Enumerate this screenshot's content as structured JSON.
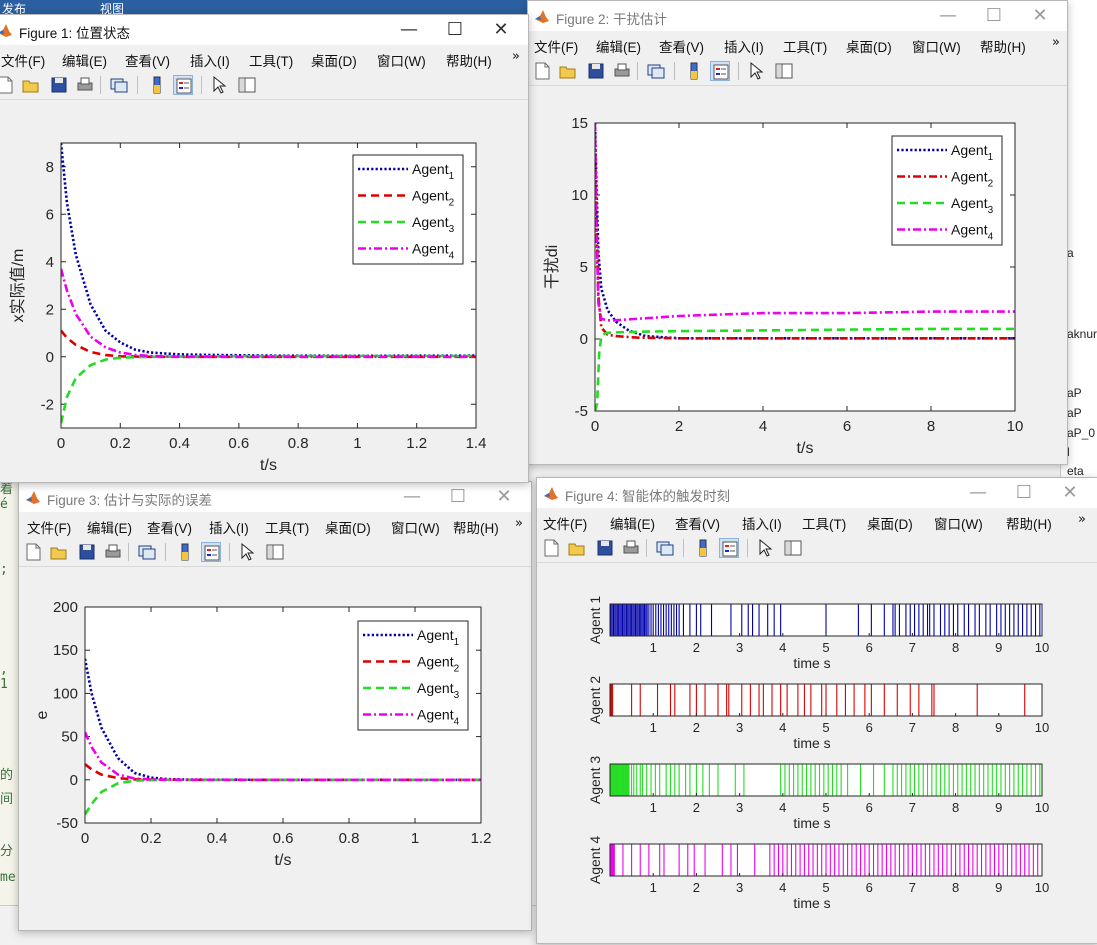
{
  "background": {
    "top_tabs": [
      "发布",
      "视图"
    ],
    "right_fragments": [
      "a",
      "aknur",
      "aP",
      "aP",
      "aP_0",
      "l",
      "eta"
    ],
    "left_fragments": [
      "着é",
      ";",
      ", 1",
      "的",
      "间",
      "分",
      "me"
    ]
  },
  "menu_labels": [
    "文件(F)",
    "编辑(E)",
    "查看(V)",
    "插入(I)",
    "工具(T)",
    "桌面(D)",
    "窗口(W)",
    "帮助(H)"
  ],
  "menu_more": "»",
  "window_controls": {
    "minimize": "—",
    "maximize": "☐",
    "close": "✕"
  },
  "toolbar_icons": [
    "new-figure-icon",
    "open-file-icon",
    "save-icon",
    "print-icon",
    "link-plot-icon",
    "insert-colorbar-icon",
    "insert-legend-icon",
    "pointer-icon",
    "property-inspector-icon"
  ],
  "colors": {
    "agent1": "#0000aa",
    "agent2": "#dd0000",
    "agent3": "#22dd22",
    "agent4": "#ee00ee",
    "matlab_gray": "#f0f0f0",
    "selected_tool": "#cfe1f5"
  },
  "legend_labels": [
    "Agent",
    "Agent",
    "Agent",
    "Agent"
  ],
  "legend_subscripts": [
    "1",
    "2",
    "3",
    "4"
  ],
  "figures": {
    "fig1": {
      "title": "Figure 1: 位置状态",
      "active": true
    },
    "fig2": {
      "title": "Figure 2: 干扰估计",
      "active": false
    },
    "fig3": {
      "title": "Figure 3: 估计与实际的误差",
      "active": false
    },
    "fig4": {
      "title": "Figure 4: 智能体的触发时刻",
      "active": false
    }
  },
  "chart_data": [
    {
      "id": "fig1",
      "type": "line",
      "xlabel": "t/s",
      "ylabel": "x实际值/m",
      "xlim": [
        0,
        1.4
      ],
      "ylim": [
        -3,
        9
      ],
      "xticks": [
        0,
        0.2,
        0.4,
        0.6,
        0.8,
        1,
        1.2,
        1.4
      ],
      "xtick_labels": [
        "0",
        "0.2",
        "0.4",
        "0.6",
        "0.8",
        "1",
        "1.2",
        "1.4"
      ],
      "yticks": [
        -2,
        0,
        2,
        4,
        6,
        8
      ],
      "ytick_labels": [
        "-2",
        "0",
        "2",
        "4",
        "6",
        "8"
      ],
      "legend": "top-right",
      "series": [
        {
          "name": "Agent1",
          "style": "dotted",
          "x": [
            0,
            0.02,
            0.05,
            0.1,
            0.15,
            0.2,
            0.25,
            0.3,
            0.4,
            0.5,
            0.7,
            1.0,
            1.4
          ],
          "y": [
            9,
            6.5,
            4.3,
            2.2,
            1.1,
            0.6,
            0.3,
            0.18,
            0.1,
            0.08,
            0.05,
            0.04,
            0.05
          ]
        },
        {
          "name": "Agent2",
          "style": "dashed",
          "x": [
            0,
            0.02,
            0.05,
            0.1,
            0.15,
            0.2,
            0.3,
            0.5,
            1.0,
            1.4
          ],
          "y": [
            1.1,
            0.8,
            0.5,
            0.2,
            0.07,
            0.02,
            0.0,
            0.0,
            0.0,
            0.0
          ]
        },
        {
          "name": "Agent3",
          "style": "dashed",
          "x": [
            0,
            0.02,
            0.05,
            0.1,
            0.15,
            0.2,
            0.3,
            0.5,
            1.0,
            1.4
          ],
          "y": [
            -2.8,
            -1.7,
            -0.9,
            -0.35,
            -0.12,
            -0.04,
            0.0,
            0.02,
            0.03,
            0.03
          ]
        },
        {
          "name": "Agent4",
          "style": "dashdot",
          "x": [
            0,
            0.02,
            0.05,
            0.1,
            0.15,
            0.2,
            0.25,
            0.3,
            0.4,
            0.6,
            1.0,
            1.4
          ],
          "y": [
            3.7,
            2.8,
            1.8,
            0.85,
            0.4,
            0.18,
            0.08,
            0.03,
            0.0,
            0.0,
            0.0,
            0.0
          ]
        }
      ]
    },
    {
      "id": "fig2",
      "type": "line",
      "xlabel": "t/s",
      "ylabel": "干扰di",
      "xlim": [
        0,
        10
      ],
      "ylim": [
        -5,
        15
      ],
      "xticks": [
        0,
        2,
        4,
        6,
        8,
        10
      ],
      "xtick_labels": [
        "0",
        "2",
        "4",
        "6",
        "8",
        "10"
      ],
      "yticks": [
        -5,
        0,
        5,
        10,
        15
      ],
      "ytick_labels": [
        "-5",
        "0",
        "5",
        "10",
        "15"
      ],
      "legend": "top-right",
      "series": [
        {
          "name": "Agent1",
          "style": "dotted",
          "x": [
            0,
            0.03,
            0.08,
            0.15,
            0.3,
            0.5,
            0.8,
            1.2,
            2,
            4,
            6,
            8,
            10
          ],
          "y": [
            15,
            11,
            6,
            3.5,
            2,
            1.2,
            0.6,
            0.2,
            0.05,
            0.05,
            0.05,
            0.05,
            0.05
          ]
        },
        {
          "name": "Agent2",
          "style": "dashdot",
          "x": [
            0,
            0.03,
            0.08,
            0.15,
            0.3,
            0.5,
            1,
            2,
            4,
            6,
            8,
            10
          ],
          "y": [
            14,
            9,
            3,
            0.8,
            0.3,
            0.2,
            0.1,
            0.05,
            0.05,
            0.05,
            0.05,
            0.05
          ]
        },
        {
          "name": "Agent3",
          "style": "dashed",
          "x": [
            0,
            0.05,
            0.1,
            0.15,
            0.25,
            0.4,
            1,
            2,
            4,
            6,
            8,
            10
          ],
          "y": [
            -5,
            -4.5,
            -1,
            0.2,
            0.4,
            0.45,
            0.5,
            0.55,
            0.6,
            0.65,
            0.7,
            0.7
          ]
        },
        {
          "name": "Agent4",
          "style": "dashdot",
          "x": [
            0,
            0.03,
            0.08,
            0.15,
            0.3,
            0.5,
            1,
            1.5,
            2,
            3,
            4,
            6,
            8,
            10
          ],
          "y": [
            15,
            8,
            2.5,
            1.4,
            1.3,
            1.3,
            1.4,
            1.5,
            1.6,
            1.7,
            1.8,
            1.8,
            1.9,
            1.9
          ]
        }
      ]
    },
    {
      "id": "fig3",
      "type": "line",
      "xlabel": "t/s",
      "ylabel": "e",
      "xlim": [
        0,
        1.2
      ],
      "ylim": [
        -50,
        200
      ],
      "xticks": [
        0,
        0.2,
        0.4,
        0.6,
        0.8,
        1,
        1.2
      ],
      "xtick_labels": [
        "0",
        "0.2",
        "0.4",
        "0.6",
        "0.8",
        "1",
        "1.2"
      ],
      "yticks": [
        -50,
        0,
        50,
        100,
        150,
        200
      ],
      "ytick_labels": [
        "-50",
        "0",
        "50",
        "100",
        "150",
        "200"
      ],
      "legend": "top-right",
      "series": [
        {
          "name": "Agent1",
          "style": "dotted",
          "x": [
            0,
            0.02,
            0.05,
            0.1,
            0.15,
            0.2,
            0.25,
            0.3,
            0.4,
            0.6,
            1.2
          ],
          "y": [
            140,
            100,
            60,
            25,
            8,
            2.5,
            0.8,
            0.3,
            0.1,
            0,
            0
          ]
        },
        {
          "name": "Agent2",
          "style": "dashed",
          "x": [
            0,
            0.02,
            0.05,
            0.1,
            0.15,
            0.2,
            0.3,
            1.2
          ],
          "y": [
            18,
            12,
            6,
            2,
            0.5,
            0.2,
            0,
            0
          ]
        },
        {
          "name": "Agent3",
          "style": "dashed",
          "x": [
            0,
            0.02,
            0.05,
            0.1,
            0.15,
            0.2,
            0.3,
            1.2
          ],
          "y": [
            -40,
            -28,
            -14,
            -4,
            -1,
            -0.3,
            0,
            0
          ]
        },
        {
          "name": "Agent4",
          "style": "dashdot",
          "x": [
            0,
            0.02,
            0.05,
            0.1,
            0.15,
            0.2,
            0.25,
            0.3,
            1.2
          ],
          "y": [
            55,
            38,
            20,
            6,
            1.5,
            0.5,
            0.1,
            0,
            0
          ]
        }
      ]
    },
    {
      "id": "fig4",
      "type": "event",
      "xlabel": "time s",
      "xlim": [
        0,
        10
      ],
      "xticks": [
        1,
        2,
        3,
        4,
        5,
        6,
        7,
        8,
        9,
        10
      ],
      "xtick_labels": [
        "1",
        "2",
        "3",
        "4",
        "5",
        "6",
        "7",
        "8",
        "9",
        "10"
      ],
      "panels": [
        {
          "name": "Agent 1",
          "times": [
            0.02,
            0.05,
            0.08,
            0.11,
            0.14,
            0.17,
            0.2,
            0.23,
            0.26,
            0.29,
            0.32,
            0.35,
            0.38,
            0.41,
            0.44,
            0.47,
            0.5,
            0.53,
            0.56,
            0.59,
            0.62,
            0.65,
            0.68,
            0.71,
            0.74,
            0.77,
            0.8,
            0.83,
            0.86,
            0.9,
            0.95,
            1.0,
            1.06,
            1.12,
            1.18,
            1.24,
            1.3,
            1.36,
            1.42,
            1.48,
            1.54,
            1.6,
            1.7,
            1.85,
            2.0,
            2.1,
            2.35,
            2.8,
            3.05,
            3.2,
            3.3,
            3.45,
            3.65,
            3.8,
            3.95,
            5.0,
            5.75,
            6.05,
            6.35,
            6.55,
            6.6,
            6.7,
            6.85,
            6.95,
            7.05,
            7.15,
            7.25,
            7.35,
            7.4,
            7.5,
            7.65,
            7.75,
            7.85,
            7.95,
            8.05,
            8.2,
            8.3,
            8.45,
            8.55,
            8.7,
            8.8,
            8.95,
            9.05,
            9.15,
            9.25,
            9.35,
            9.45,
            9.55,
            9.65,
            9.75,
            9.85,
            9.95
          ]
        },
        {
          "name": "Agent 2",
          "times": [
            0.02,
            0.04,
            0.06,
            0.5,
            0.7,
            1.1,
            1.4,
            1.5,
            1.85,
            2.0,
            2.2,
            2.5,
            2.7,
            2.75,
            3.05,
            3.25,
            3.45,
            3.55,
            3.75,
            3.95,
            4.1,
            4.35,
            4.5,
            4.65,
            4.9,
            5.0,
            5.25,
            5.45,
            5.65,
            5.9,
            6.05,
            6.35,
            6.65,
            6.95,
            7.15,
            7.45,
            7.5,
            8.5,
            9.6
          ]
        },
        {
          "name": "Agent 3",
          "times": [
            0.02,
            0.04,
            0.06,
            0.08,
            0.1,
            0.12,
            0.14,
            0.16,
            0.18,
            0.2,
            0.22,
            0.24,
            0.26,
            0.28,
            0.3,
            0.32,
            0.34,
            0.36,
            0.38,
            0.4,
            0.42,
            0.44,
            0.5,
            0.55,
            0.62,
            0.7,
            0.75,
            0.85,
            0.95,
            1.05,
            1.15,
            1.3,
            1.4,
            1.5,
            1.6,
            1.75,
            1.85,
            2.0,
            2.15,
            2.3,
            2.5,
            2.9,
            3.1,
            3.95,
            4.05,
            4.15,
            4.25,
            4.35,
            4.45,
            4.55,
            4.65,
            4.75,
            4.85,
            4.95,
            5.05,
            5.15,
            5.25,
            5.35,
            5.5,
            5.8,
            6.1,
            6.35,
            6.55,
            6.65,
            6.75,
            6.85,
            6.95,
            7.05,
            7.15,
            7.25,
            7.35,
            7.45,
            7.55,
            7.65,
            7.75,
            7.85,
            7.95,
            8.05,
            8.15,
            8.25,
            8.35,
            8.45,
            8.55,
            8.65,
            8.75,
            8.85,
            8.95,
            9.05,
            9.15,
            9.25,
            9.35,
            9.45,
            9.55,
            9.65,
            9.75,
            9.85,
            9.95
          ]
        },
        {
          "name": "Agent 4",
          "times": [
            0.02,
            0.04,
            0.06,
            0.08,
            0.1,
            0.3,
            0.5,
            0.7,
            0.9,
            1.15,
            1.25,
            1.6,
            1.8,
            1.95,
            2.2,
            2.6,
            2.8,
            2.95,
            3.35,
            3.7,
            3.8,
            3.9,
            4.0,
            4.1,
            4.2,
            4.3,
            4.4,
            4.5,
            4.6,
            4.7,
            4.8,
            4.9,
            5.0,
            5.1,
            5.2,
            5.3,
            5.4,
            5.5,
            5.6,
            5.7,
            5.8,
            5.9,
            6.0,
            6.1,
            6.2,
            6.3,
            6.4,
            6.5,
            6.6,
            6.7,
            6.8,
            6.9,
            7.0,
            7.1,
            7.2,
            7.3,
            7.4,
            7.5,
            7.6,
            7.7,
            7.8,
            7.9,
            8.0,
            8.1,
            8.2,
            8.3,
            8.4,
            8.5,
            8.6,
            8.7,
            8.8,
            8.9,
            9.0,
            9.1,
            9.2,
            9.3,
            9.4,
            9.5,
            9.6,
            9.7,
            9.8,
            9.9
          ]
        }
      ]
    }
  ]
}
